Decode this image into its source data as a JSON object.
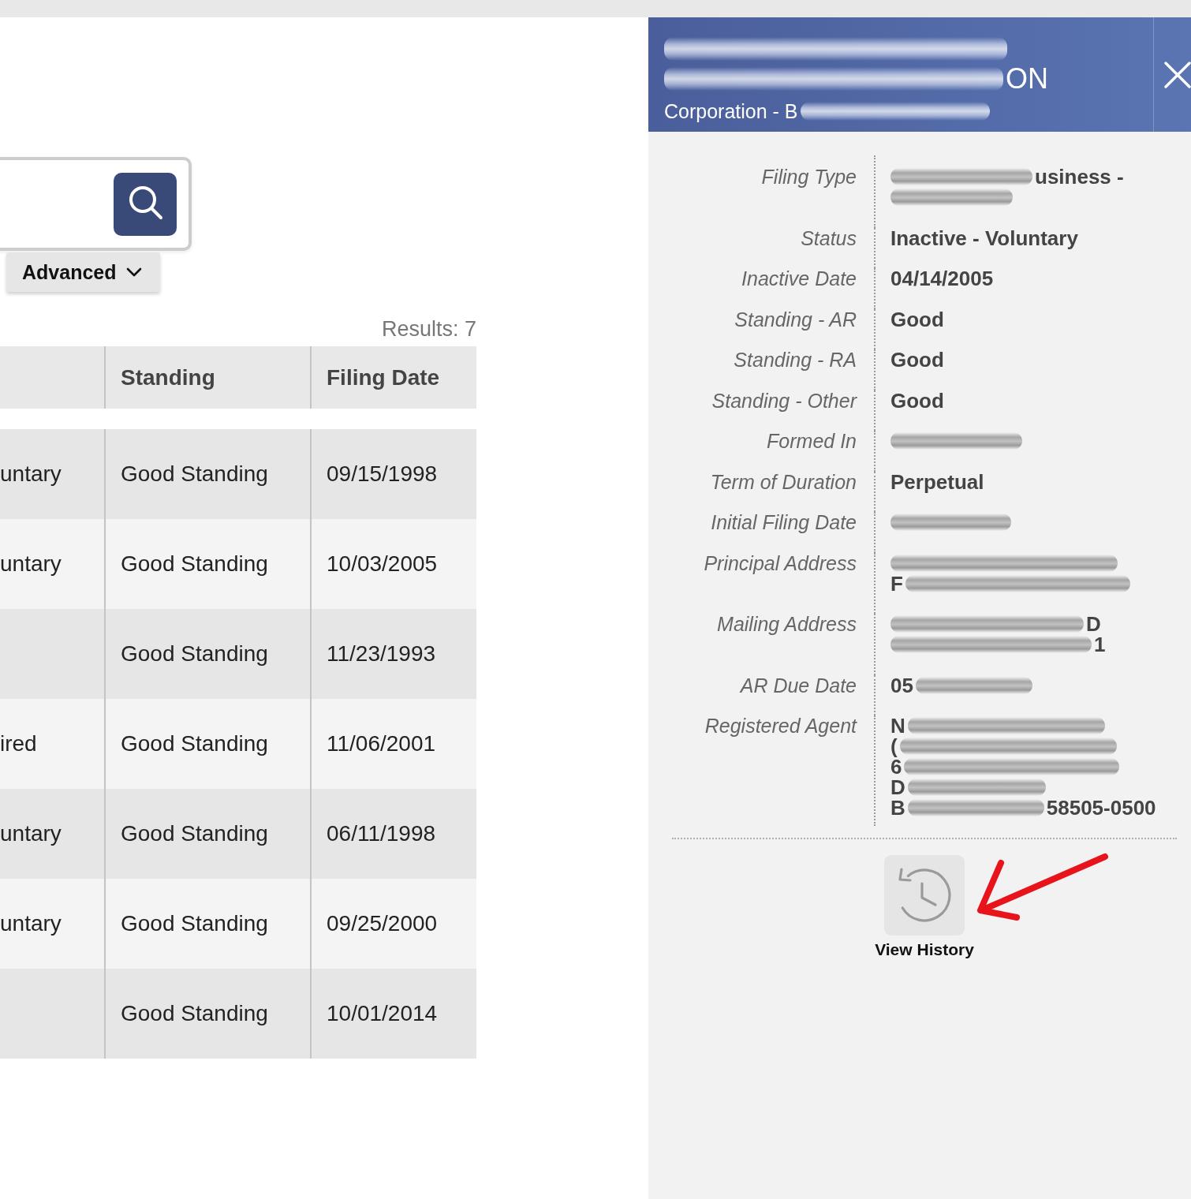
{
  "search_bar": {
    "advanced_button": {
      "label": "Advanced"
    }
  },
  "results": {
    "count": "Results: 7"
  },
  "table": {
    "columns": [
      {
        "label": "Standing"
      },
      {
        "label": "Filing Date"
      }
    ],
    "rows": [
      {
        "column_1": "untary",
        "standing": "Good Standing",
        "filing_date": "09/15/1998"
      },
      {
        "column_1": "untary",
        "standing": "Good Standing",
        "filing_date": "10/03/2005"
      },
      {
        "standing": "Good Standing",
        "filing_date": "11/23/1993"
      },
      {
        "column_1": "ired",
        "standing": "Good Standing",
        "filing_date": "11/06/2001"
      },
      {
        "column_1": "untary",
        "standing": "Good Standing",
        "filing_date": "06/11/1998"
      },
      {
        "column_1": "untary",
        "standing": "Good Standing",
        "filing_date": "09/25/2000"
      },
      {
        "standing": "Good Standing",
        "filing_date": "10/01/2014"
      }
    ]
  },
  "detail_panel": {
    "header": {
      "title_lines": [
        [
          {
            "kind": "redacted"
          }
        ],
        [
          {
            "kind": "redacted"
          },
          {
            "kind": "text",
            "text": "ON"
          }
        ]
      ],
      "subtitle": [
        {
          "kind": "text",
          "text": "Corporation - B"
        },
        {
          "kind": "redacted"
        }
      ]
    },
    "fields": [
      {
        "label": "Filing Type",
        "lines": [
          [
            {
              "kind": "redacted"
            },
            {
              "kind": "text",
              "text": "usiness -"
            }
          ],
          [
            {
              "kind": "redacted"
            }
          ]
        ]
      },
      {
        "label": "Status",
        "lines": [
          [
            {
              "kind": "text",
              "text": "Inactive - Voluntary"
            }
          ]
        ]
      },
      {
        "label": "Inactive Date",
        "lines": [
          [
            {
              "kind": "text",
              "text": "04/14/2005"
            }
          ]
        ]
      },
      {
        "label": "Standing - AR",
        "lines": [
          [
            {
              "kind": "text",
              "text": "Good"
            }
          ]
        ]
      },
      {
        "label": "Standing - RA",
        "lines": [
          [
            {
              "kind": "text",
              "text": "Good"
            }
          ]
        ]
      },
      {
        "label": "Standing - Other",
        "lines": [
          [
            {
              "kind": "text",
              "text": "Good"
            }
          ]
        ]
      },
      {
        "label": "Formed In",
        "lines": [
          [
            {
              "kind": "redacted"
            }
          ]
        ]
      },
      {
        "label": "Term of Duration",
        "lines": [
          [
            {
              "kind": "text",
              "text": "Perpetual"
            }
          ]
        ]
      },
      {
        "label": "Initial Filing Date",
        "lines": [
          [
            {
              "kind": "redacted"
            }
          ]
        ]
      },
      {
        "label": "Principal Address",
        "lines": [
          [
            {
              "kind": "redacted"
            }
          ],
          [
            {
              "kind": "text",
              "text": "F"
            },
            {
              "kind": "redacted"
            }
          ]
        ]
      },
      {
        "label": "Mailing Address",
        "lines": [
          [
            {
              "kind": "redacted"
            },
            {
              "kind": "text",
              "text": "D"
            }
          ],
          [
            {
              "kind": "redacted"
            },
            {
              "kind": "text",
              "text": "1"
            }
          ]
        ]
      },
      {
        "label": "AR Due Date",
        "lines": [
          [
            {
              "kind": "text",
              "text": "05"
            },
            {
              "kind": "redacted"
            }
          ]
        ]
      },
      {
        "label": "Registered Agent",
        "lines": [
          [
            {
              "kind": "text",
              "text": "N"
            },
            {
              "kind": "redacted"
            }
          ],
          [
            {
              "kind": "text",
              "text": "("
            },
            {
              "kind": "redacted"
            }
          ],
          [
            {
              "kind": "text",
              "text": "6"
            },
            {
              "kind": "redacted"
            }
          ],
          [
            {
              "kind": "text",
              "text": "D"
            },
            {
              "kind": "redacted"
            }
          ],
          [
            {
              "kind": "text",
              "text": "B"
            },
            {
              "kind": "redacted"
            },
            {
              "kind": "text",
              "text": "58505-0500"
            }
          ]
        ]
      }
    ],
    "view_history_button": {
      "label": "View History"
    }
  }
}
